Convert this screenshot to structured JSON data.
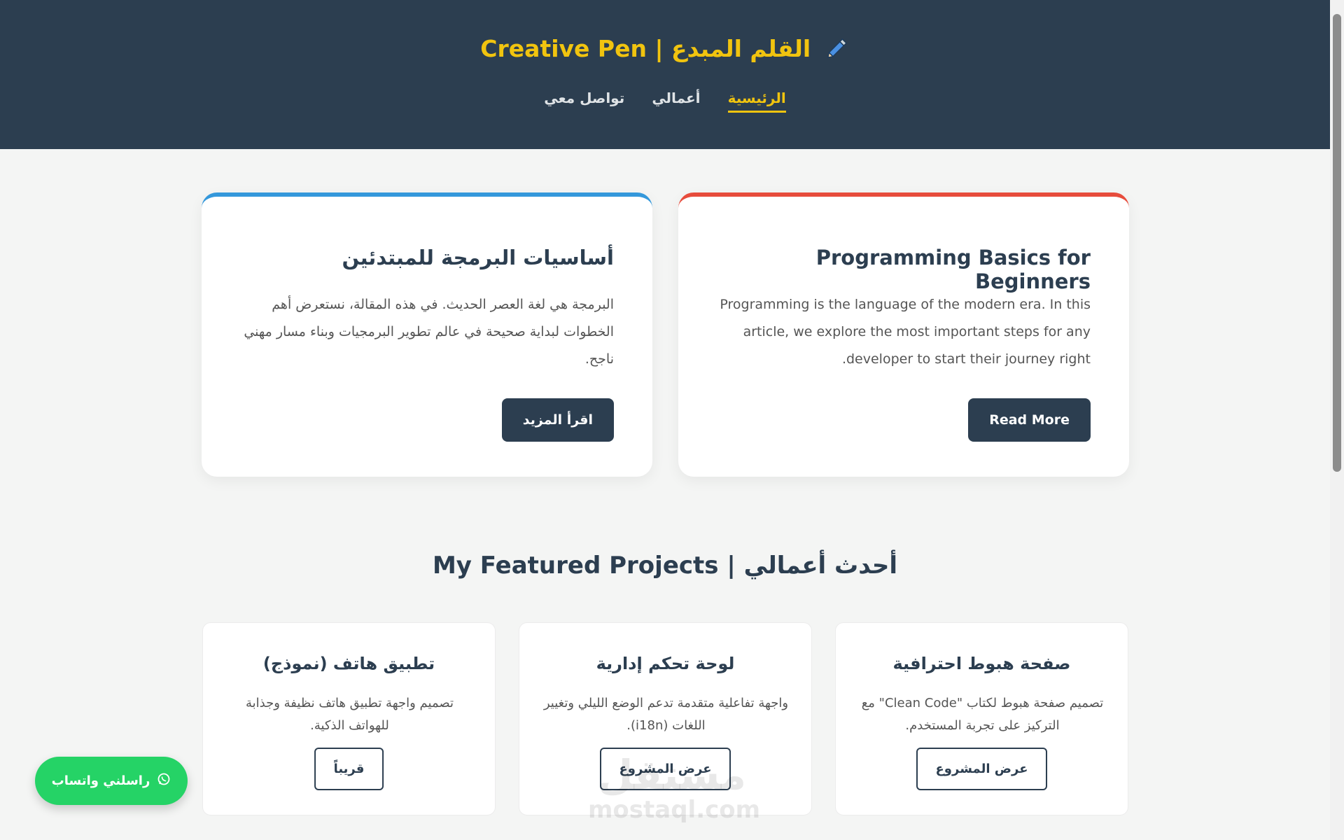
{
  "header": {
    "title": "Creative Pen | القلم المبدع",
    "icon": "pencil-icon",
    "nav": [
      {
        "label": "الرئيسية",
        "active": true
      },
      {
        "label": "أعمالي",
        "active": false
      },
      {
        "label": "تواصل معي",
        "active": false
      }
    ]
  },
  "articles": {
    "arabic": {
      "title": "أساسيات البرمجة للمبتدئين",
      "body": "البرمجة هي لغة العصر الحديث. في هذه المقالة، نستعرض أهم الخطوات لبداية صحيحة في عالم تطوير البرمجيات وبناء مسار مهني ناجح.",
      "button": "اقرأ المزيد",
      "accent": "#3498db"
    },
    "english": {
      "title": "Programming Basics for Beginners",
      "body": "Programming is the language of the modern era. In this article, we explore the most important steps for any developer to start their journey right.",
      "button": "Read More",
      "accent": "#e74c3c"
    }
  },
  "projects": {
    "title": "My Featured Projects | أحدث أعمالي",
    "items": [
      {
        "title": "صفحة هبوط احترافية",
        "description": "تصميم صفحة هبوط لكتاب \"Clean Code\" مع التركيز على تجربة المستخدم.",
        "button": "عرض المشروع"
      },
      {
        "title": "لوحة تحكم إدارية",
        "description": "واجهة تفاعلية متقدمة تدعم الوضع الليلي وتغيير اللغات (i18n).",
        "button": "عرض المشروع"
      },
      {
        "title": "تطبيق هاتف (نموذج)",
        "description": "تصميم واجهة تطبيق هاتف نظيفة وجذابة للهواتف الذكية.",
        "button": "قريباً"
      }
    ]
  },
  "whatsapp": {
    "label": "راسلني واتساب",
    "icon": "whatsapp-icon",
    "color": "#25d366"
  },
  "watermark": {
    "arabic": "مستقل",
    "latin": "mostaql.com"
  },
  "colors": {
    "header_bg": "#2c3e50",
    "accent_yellow": "#f1c40f"
  }
}
